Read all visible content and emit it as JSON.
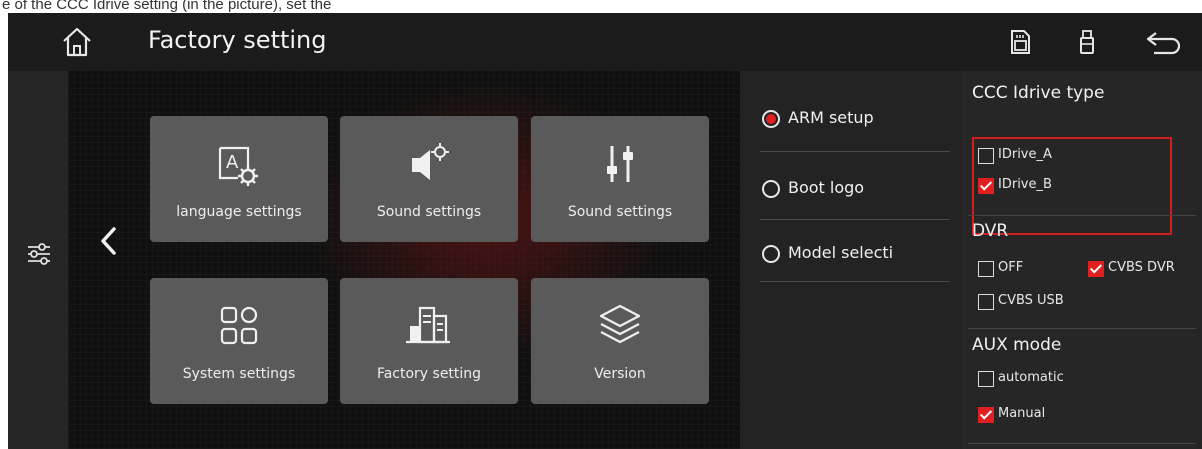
{
  "caption_fragment": "e of the CCC Idrive setting (in the picture), set the",
  "header": {
    "title": "Factory setting"
  },
  "tiles": [
    {
      "label": "language settings"
    },
    {
      "label": "Sound settings"
    },
    {
      "label": "Sound settings"
    },
    {
      "label": "System settings"
    },
    {
      "label": "Factory setting"
    },
    {
      "label": "Version"
    }
  ],
  "menu": [
    {
      "label": "ARM setup",
      "selected": true
    },
    {
      "label": "Boot logo",
      "selected": false
    },
    {
      "label": "Model selecti",
      "selected": false
    }
  ],
  "settings": {
    "idrive": {
      "title": "CCC Idrive type",
      "options": [
        {
          "label": "IDrive_A",
          "checked": false
        },
        {
          "label": "IDrive_B",
          "checked": true
        }
      ]
    },
    "dvr": {
      "title": "DVR",
      "options": [
        {
          "label": "OFF",
          "checked": false
        },
        {
          "label": "CVBS DVR",
          "checked": true
        },
        {
          "label": "CVBS USB",
          "checked": false
        }
      ]
    },
    "aux": {
      "title": "AUX mode",
      "options": [
        {
          "label": "automatic",
          "checked": false
        },
        {
          "label": "Manual",
          "checked": true
        }
      ]
    }
  },
  "colors": {
    "accent": "#e02020",
    "highlight_border": "#d11e1e",
    "tile_bg": "#5a5a5a"
  },
  "icons": {
    "home": "home-icon",
    "sd_card": "sd-card-icon",
    "usb": "usb-icon",
    "back": "return-arrow-icon",
    "sliders": "sliders-icon",
    "chevron": "chevron-left-icon"
  }
}
